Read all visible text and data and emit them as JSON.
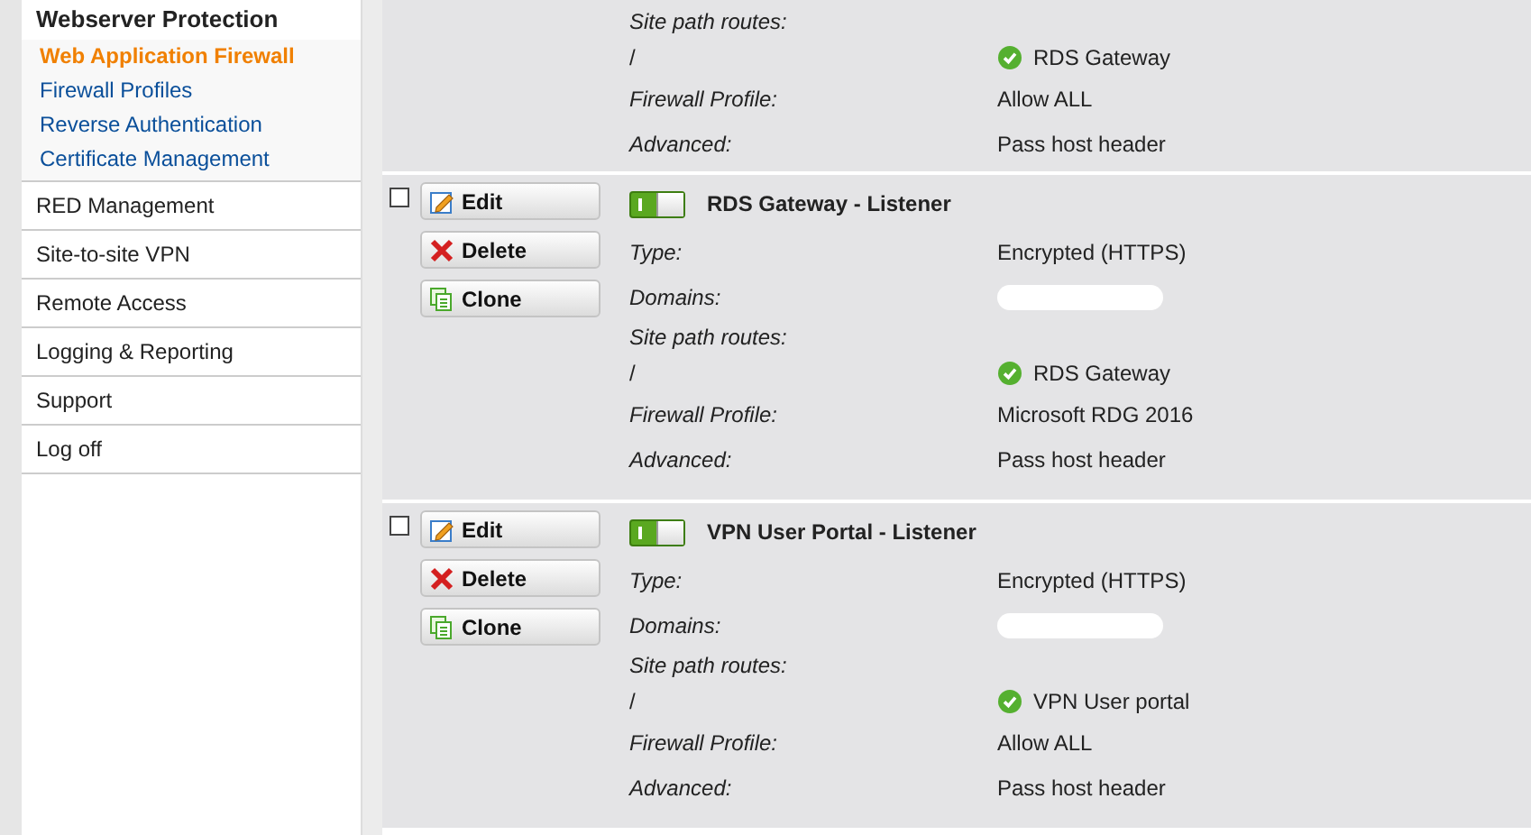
{
  "sidebar": {
    "section": {
      "title": "Webserver Protection",
      "items": [
        {
          "label": "Web Application Firewall",
          "selected": true
        },
        {
          "label": "Firewall Profiles",
          "selected": false
        },
        {
          "label": "Reverse Authentication",
          "selected": false
        },
        {
          "label": "Certificate Management",
          "selected": false
        }
      ]
    },
    "items": [
      {
        "label": "RED Management"
      },
      {
        "label": "Site-to-site VPN"
      },
      {
        "label": "Remote Access"
      },
      {
        "label": "Logging & Reporting"
      },
      {
        "label": "Support"
      },
      {
        "label": "Log off"
      }
    ]
  },
  "listeners": [
    {
      "kind": "continued",
      "fields": [
        {
          "kind": "heading",
          "label": "Site path routes:"
        },
        {
          "kind": "route",
          "label": "/",
          "value": "RDS Gateway"
        },
        {
          "kind": "text",
          "label": "Firewall Profile:",
          "value": "Allow ALL"
        },
        {
          "kind": "text",
          "label": "Advanced:",
          "value": "Pass host header"
        }
      ]
    },
    {
      "kind": "full",
      "title": "RDS Gateway - Listener",
      "enabled": true,
      "checked": false,
      "buttons": [
        "Edit",
        "Delete",
        "Clone"
      ],
      "fields": [
        {
          "kind": "text",
          "label": "Type:",
          "value": "Encrypted (HTTPS)"
        },
        {
          "kind": "redacted",
          "label": "Domains:"
        },
        {
          "kind": "heading",
          "label": "Site path routes:"
        },
        {
          "kind": "route",
          "label": "/",
          "value": "RDS Gateway"
        },
        {
          "kind": "text",
          "label": "Firewall Profile:",
          "value": "Microsoft RDG 2016"
        },
        {
          "kind": "text",
          "label": "Advanced:",
          "value": "Pass host header"
        }
      ]
    },
    {
      "kind": "full",
      "title": "VPN User Portal - Listener",
      "enabled": true,
      "checked": false,
      "buttons": [
        "Edit",
        "Delete",
        "Clone"
      ],
      "fields": [
        {
          "kind": "text",
          "label": "Type:",
          "value": "Encrypted (HTTPS)"
        },
        {
          "kind": "redacted",
          "label": "Domains:"
        },
        {
          "kind": "heading",
          "label": "Site path routes:"
        },
        {
          "kind": "route",
          "label": "/",
          "value": "VPN User portal"
        },
        {
          "kind": "text",
          "label": "Firewall Profile:",
          "value": "Allow ALL"
        },
        {
          "kind": "text",
          "label": "Advanced:",
          "value": "Pass host header"
        }
      ]
    }
  ]
}
